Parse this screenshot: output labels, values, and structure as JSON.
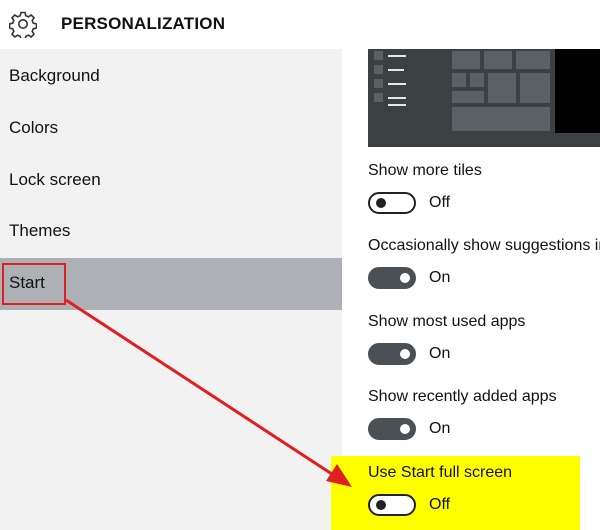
{
  "header": {
    "title": "PERSONALIZATION",
    "icon": "gear-icon"
  },
  "sidebar": {
    "items": [
      {
        "label": "Background"
      },
      {
        "label": "Colors"
      },
      {
        "label": "Lock screen"
      },
      {
        "label": "Themes"
      },
      {
        "label": "Start",
        "selected": true
      }
    ]
  },
  "settings": [
    {
      "label": "Show more tiles",
      "state": "Off",
      "on": false
    },
    {
      "label": "Occasionally show suggestions in",
      "state": "On",
      "on": true
    },
    {
      "label": "Show most used apps",
      "state": "On",
      "on": true
    },
    {
      "label": "Show recently added apps",
      "state": "On",
      "on": true
    },
    {
      "label": "Use Start full screen",
      "state": "Off",
      "on": false
    }
  ],
  "colors": {
    "accent": "#4b5054",
    "selected_nav": "#adb0b4",
    "highlight": "#ffff00",
    "annotation": "#e02020"
  }
}
